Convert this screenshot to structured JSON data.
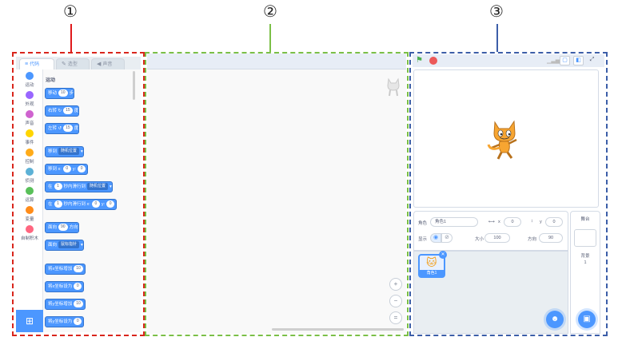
{
  "annotations": {
    "label1": "①",
    "label2": "②",
    "label3": "③"
  },
  "colors": {
    "red": "#e0191b",
    "green": "#7bbf47",
    "blue": "#3c5ea8",
    "accent": "#4c97ff"
  },
  "tabs": [
    {
      "icon": "code-icon",
      "label": "代码"
    },
    {
      "icon": "brush-icon",
      "label": "造型"
    },
    {
      "icon": "speaker-icon",
      "label": "声音"
    }
  ],
  "categories": [
    {
      "label": "运动",
      "color": "#4c97ff"
    },
    {
      "label": "外观",
      "color": "#9966ff"
    },
    {
      "label": "声音",
      "color": "#cf63cf"
    },
    {
      "label": "事件",
      "color": "#ffd500"
    },
    {
      "label": "控制",
      "color": "#ffab19"
    },
    {
      "label": "侦测",
      "color": "#5cb1d6"
    },
    {
      "label": "运算",
      "color": "#59c059"
    },
    {
      "label": "变量",
      "color": "#ff8c1a"
    },
    {
      "label": "自制积木",
      "color": "#ff6680"
    }
  ],
  "palette": {
    "section": "运动",
    "blocks": {
      "move": {
        "a": "移动",
        "v": "10",
        "b": "步"
      },
      "turn_right": {
        "a": "右转",
        "v": "15",
        "b": "度"
      },
      "turn_left": {
        "a": "左转",
        "v": "15",
        "b": "度"
      },
      "goto": {
        "a": "移到",
        "dd": "随机位置"
      },
      "goto_xy": {
        "a": "移到 x:",
        "x": "0",
        "b": "y:",
        "y": "0"
      },
      "glide": {
        "a": "在",
        "v": "1",
        "b": "秒内滑行到",
        "dd": "随机位置"
      },
      "glide_xy": {
        "a": "在",
        "v": "1",
        "b": "秒内滑行到 x:",
        "x": "0",
        "c": "y:",
        "y": "0"
      },
      "point": {
        "a": "面向",
        "v": "90",
        "b": "方向"
      },
      "point_towards": {
        "a": "面向",
        "dd": "鼠标指针"
      },
      "change_x": {
        "a": "将x坐标增加",
        "v": "10"
      },
      "set_x": {
        "a": "将x坐标设为",
        "v": "0"
      },
      "change_y": {
        "a": "将y坐标增加",
        "v": "10"
      },
      "set_y": {
        "a": "将y坐标设为",
        "v": "0"
      }
    }
  },
  "zoom": {
    "in": "+",
    "out": "−",
    "reset": "="
  },
  "sprite_info": {
    "sprite_label": "角色",
    "sprite_name": "角色1",
    "x_label": "x",
    "x_value": "0",
    "y_label": "y",
    "y_value": "0",
    "show_label": "显示",
    "size_label": "大小",
    "size_value": "100",
    "direction_label": "方向",
    "direction_value": "90"
  },
  "sprite_card": {
    "name": "角色1"
  },
  "stage_panel": {
    "title": "舞台",
    "backdrop_label": "背景",
    "backdrop_count": "1"
  }
}
